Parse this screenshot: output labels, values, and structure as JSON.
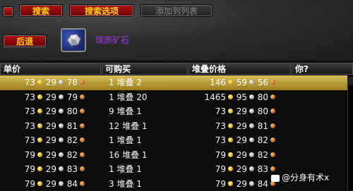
{
  "toolbar": {
    "search_label": "搜索",
    "search_options_label": "搜索选项",
    "add_to_list_label": "添加到列表"
  },
  "back_label": "后退",
  "item": {
    "name": "瑞质矿石",
    "icon": "ore-icon"
  },
  "columns": {
    "unit_price": "单价",
    "available": "可购买",
    "stack_price": "堆叠价格",
    "you": "你?"
  },
  "rows": [
    {
      "unit": {
        "g": "73",
        "s": "29",
        "c": "78"
      },
      "avail": "1 堆叠 2",
      "stack": {
        "g": "146",
        "s": "59",
        "c": "56"
      },
      "selected": true
    },
    {
      "unit": {
        "g": "73",
        "s": "29",
        "c": "79"
      },
      "avail": "1 堆叠 20",
      "stack": {
        "g": "1465",
        "s": "95",
        "c": "80"
      }
    },
    {
      "unit": {
        "g": "73",
        "s": "29",
        "c": "80"
      },
      "avail": "9 堆叠 1",
      "stack": {
        "g": "73",
        "s": "29",
        "c": "80"
      }
    },
    {
      "unit": {
        "g": "73",
        "s": "29",
        "c": "81"
      },
      "avail": "12 堆叠 1",
      "stack": {
        "g": "73",
        "s": "29",
        "c": "81"
      }
    },
    {
      "unit": {
        "g": "73",
        "s": "29",
        "c": "82"
      },
      "avail": "1 堆叠 1",
      "stack": {
        "g": "73",
        "s": "29",
        "c": "82"
      }
    },
    {
      "unit": {
        "g": "79",
        "s": "29",
        "c": "82"
      },
      "avail": "16 堆叠 1",
      "stack": {
        "g": "79",
        "s": "29",
        "c": "82"
      }
    },
    {
      "unit": {
        "g": "79",
        "s": "29",
        "c": "83"
      },
      "avail": "1 堆叠 1",
      "stack": {
        "g": "79",
        "s": "29",
        "c": "83"
      }
    },
    {
      "unit": {
        "g": "79",
        "s": "29",
        "c": "84"
      },
      "avail": "3 堆叠 1",
      "stack": {
        "g": "79",
        "s": "29",
        "c": "84"
      }
    }
  ],
  "watermark": "@分身有术x",
  "colors": {
    "item_quality": "#a335ee",
    "button_text": "#ffd200"
  }
}
